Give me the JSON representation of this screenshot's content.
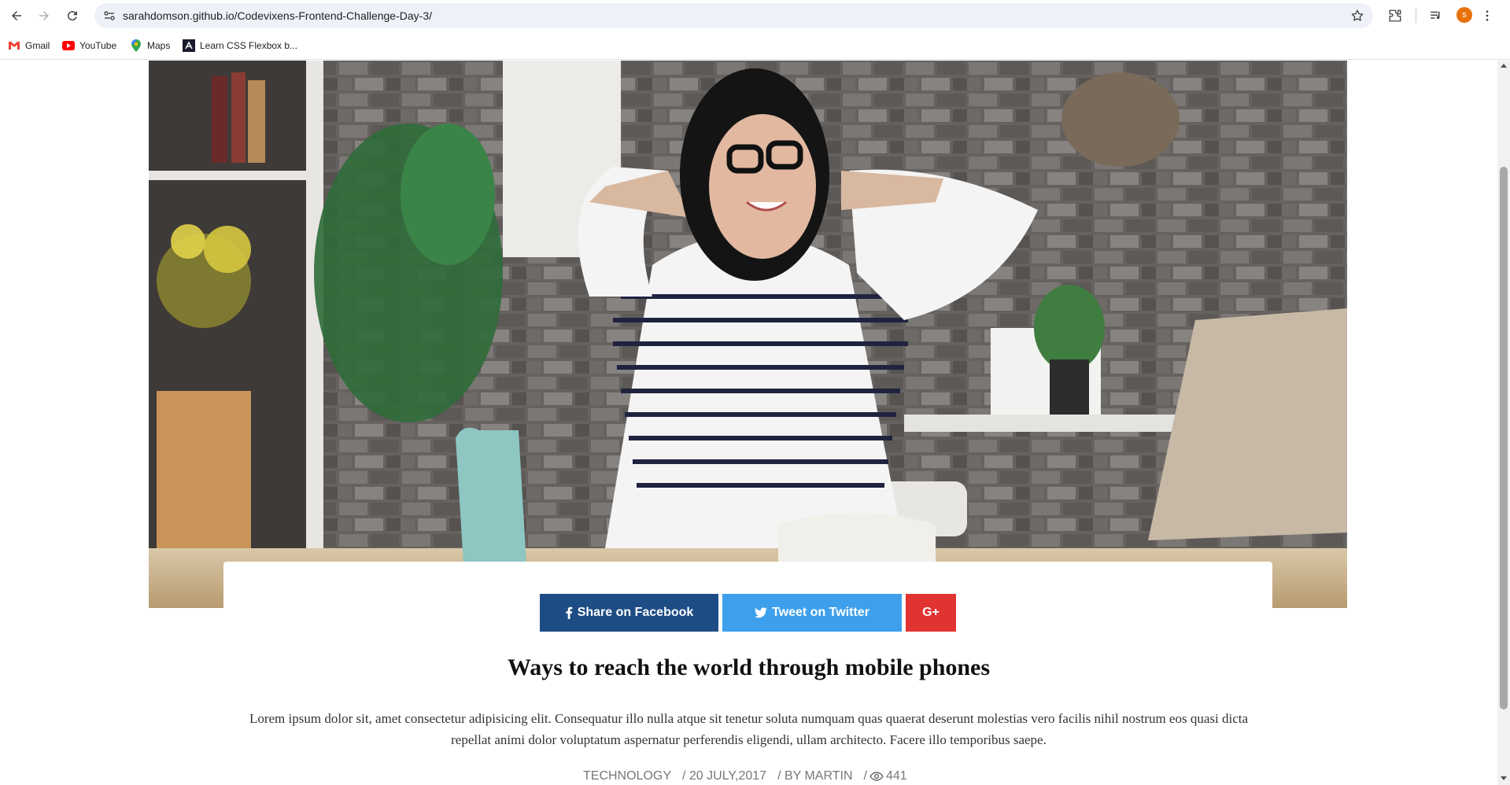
{
  "browser": {
    "url": "sarahdomson.github.io/Codevixens-Frontend-Challenge-Day-3/",
    "profile_initial": "s",
    "bookmarks": [
      {
        "label": "Gmail",
        "icon": "gmail-icon"
      },
      {
        "label": "YouTube",
        "icon": "youtube-icon"
      },
      {
        "label": "Maps",
        "icon": "maps-icon"
      },
      {
        "label": "Learn CSS Flexbox b...",
        "icon": "flexbox-icon"
      }
    ]
  },
  "hero": {
    "image": "photo-woman-relaxing-at-desk"
  },
  "share": {
    "facebook_label": "Share on Facebook",
    "twitter_label": "Tweet on Twitter",
    "googleplus_label": "G+",
    "colors": {
      "facebook": "#1e4d86",
      "twitter": "#3ea0ec",
      "googleplus": "#e23333"
    }
  },
  "article": {
    "title": "Ways to reach the world through mobile phones",
    "description": "Lorem ipsum dolor sit, amet consectetur adipisicing elit. Consequatur illo nulla atque sit tenetur soluta numquam quas quaerat deserunt molestias vero facilis nihil nostrum eos quasi dicta repellat animi dolor voluptatum aspernatur perferendis eligendi, ullam architecto. Facere illo temporibus saepe.",
    "category": "TECHNOLOGY",
    "date": "/ 20 JULY,2017",
    "author": "/ BY MARTIN",
    "views_prefix": "/",
    "views": "441"
  }
}
